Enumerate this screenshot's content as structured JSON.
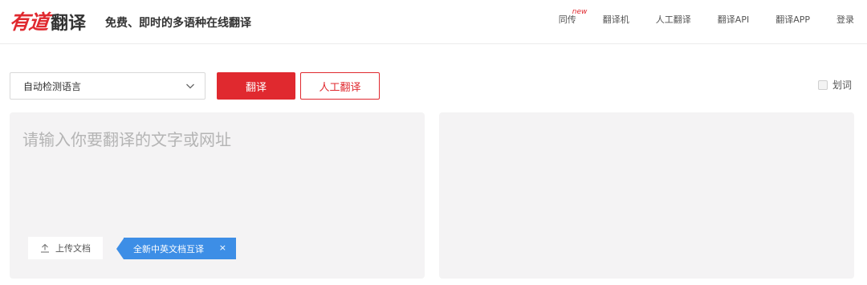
{
  "header": {
    "logo_youdao": "有道",
    "logo_fanyi": "翻译",
    "slogan": "免费、即时的多语种在线翻译",
    "nav": [
      {
        "label": "同传",
        "badge": "new"
      },
      {
        "label": "翻译机"
      },
      {
        "label": "人工翻译"
      },
      {
        "label": "翻译API"
      },
      {
        "label": "翻译APP"
      },
      {
        "label": "登录"
      }
    ]
  },
  "toolbar": {
    "language_value": "自动检测语言",
    "translate_label": "翻译",
    "human_translate_label": "人工翻译",
    "word_pick_label": "划词",
    "word_pick_checked": false
  },
  "input": {
    "placeholder": "请输入你要翻译的文字或网址",
    "value": "",
    "upload_label": "上传文档",
    "promo_label": "全新中英文档互译",
    "promo_close": "×"
  },
  "colors": {
    "brand_red": "#e0292f",
    "promo_blue": "#3d8ee6",
    "panel_bg": "#f4f3f4"
  }
}
